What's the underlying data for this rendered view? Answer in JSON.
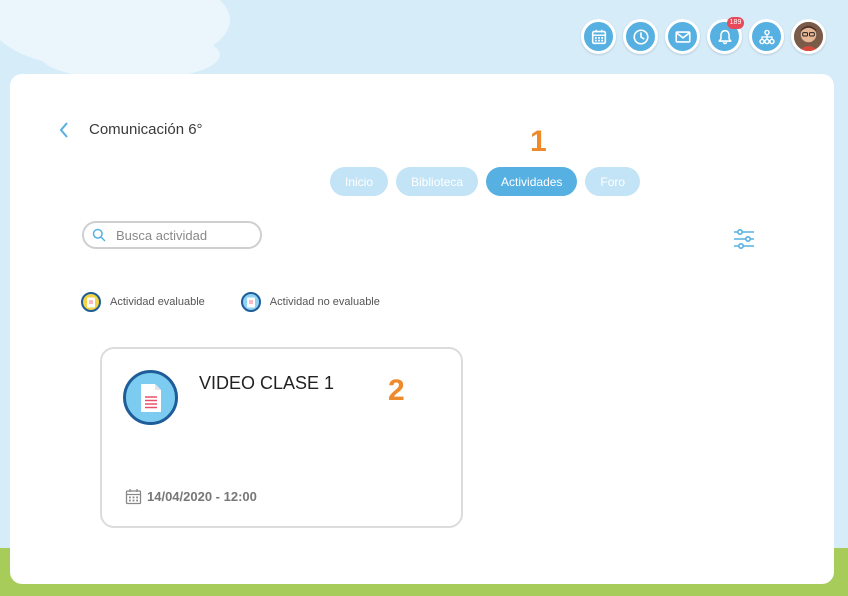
{
  "header": {
    "notification_badge": "189",
    "buttons": [
      "calendar-icon",
      "clock-icon",
      "mail-icon",
      "bell-icon",
      "sitemap-icon"
    ],
    "accent": "#56b0e1"
  },
  "page": {
    "title": "Comunicación 6°"
  },
  "tabs": [
    {
      "label": "Inicio",
      "active": false
    },
    {
      "label": "Biblioteca",
      "active": false
    },
    {
      "label": "Actividades",
      "active": true
    },
    {
      "label": "Foro",
      "active": false
    }
  ],
  "search": {
    "placeholder": "Busca actividad",
    "value": ""
  },
  "legend": {
    "evaluable": "Actividad evaluable",
    "no_evaluable": "Actividad no evaluable"
  },
  "activities": [
    {
      "title": "VIDEO CLASE 1",
      "date": "14/04/2020 - 12:00",
      "type": "no_evaluable"
    }
  ],
  "annotations": {
    "one": "1",
    "two": "2"
  }
}
